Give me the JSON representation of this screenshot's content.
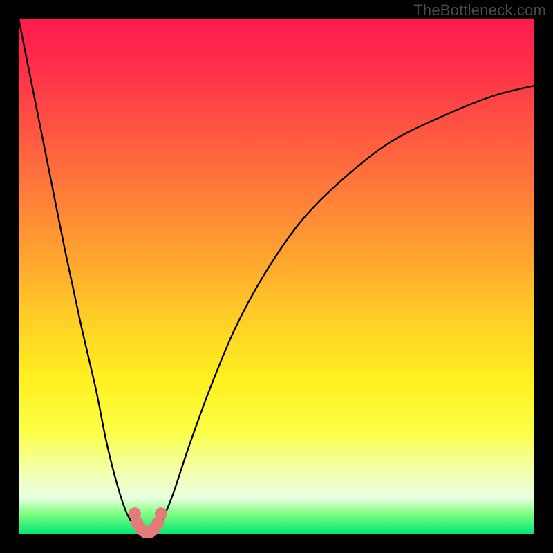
{
  "watermark": "TheBottleneck.com",
  "chart_data": {
    "type": "line",
    "title": "",
    "xlabel": "",
    "ylabel": "",
    "xlim": [
      0,
      100
    ],
    "ylim": [
      0,
      100
    ],
    "series": [
      {
        "name": "bottleneck-curve",
        "x": [
          0,
          3,
          6,
          9,
          12,
          15,
          17,
          19,
          21,
          23,
          24,
          25,
          26,
          27,
          28,
          30,
          33,
          37,
          42,
          48,
          55,
          63,
          72,
          82,
          92,
          100
        ],
        "values": [
          100,
          85,
          70,
          55,
          41,
          28,
          18,
          10,
          4,
          1,
          0,
          0,
          0,
          1,
          3,
          8,
          17,
          28,
          40,
          51,
          61,
          69,
          76,
          81,
          85,
          87
        ]
      }
    ],
    "markers": {
      "name": "highlight-region",
      "color": "#e47a7a",
      "x": [
        22.5,
        23.0,
        23.8,
        24.6,
        25.4,
        26.2,
        27.0,
        27.6
      ],
      "values": [
        4.0,
        2.2,
        1.0,
        0.4,
        0.4,
        1.0,
        2.2,
        4.0
      ]
    }
  }
}
